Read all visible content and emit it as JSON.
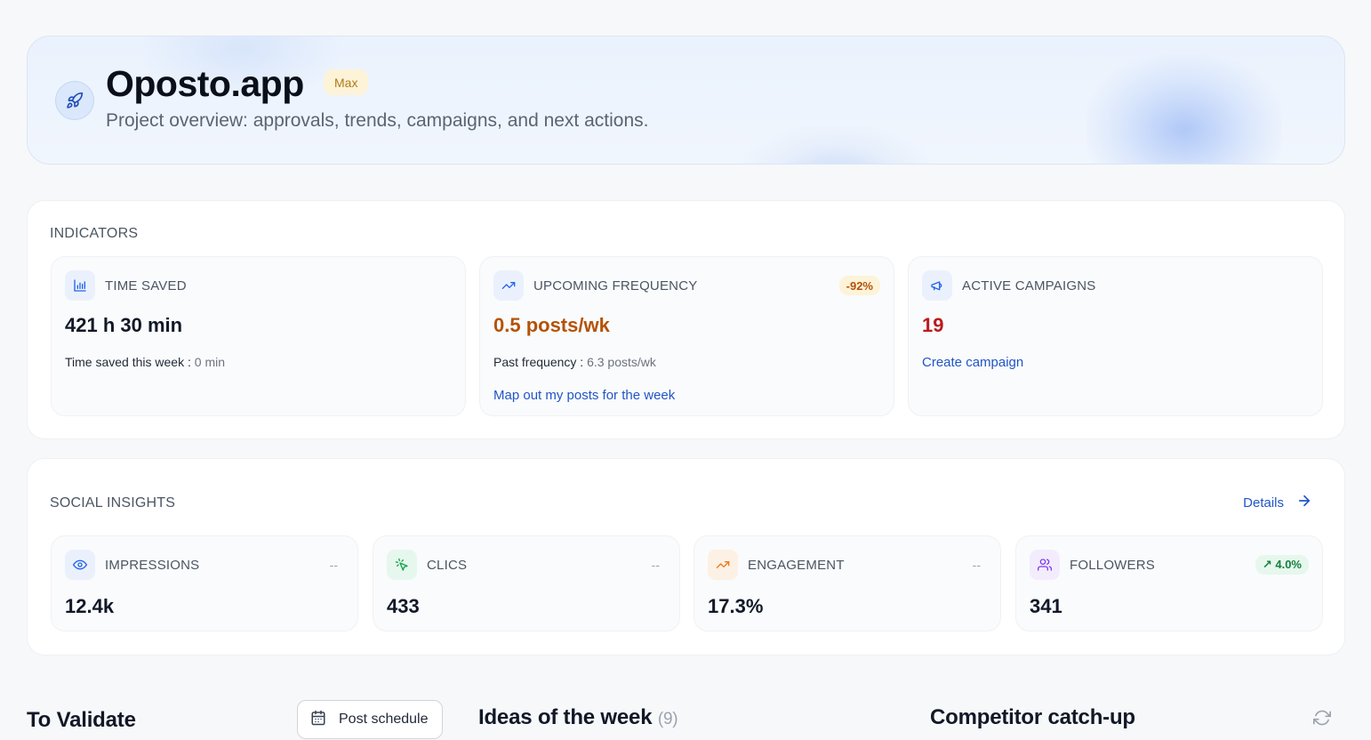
{
  "header": {
    "title": "Oposto.app",
    "badge": "Max",
    "subtitle": "Project overview: approvals, trends, campaigns, and next actions.",
    "icon": "rocket-icon"
  },
  "indicators": {
    "section_title": "INDICATORS",
    "time_saved": {
      "label": "TIME SAVED",
      "icon": "bar-chart-icon",
      "value": "421 h 30 min",
      "sub_label": "Time saved this week :",
      "sub_value": "0 min"
    },
    "upcoming_frequency": {
      "label": "UPCOMING FREQUENCY",
      "icon": "trend-up-icon",
      "badge": "-92%",
      "value": "0.5 posts/wk",
      "sub_label": "Past frequency :",
      "sub_value": "6.3 posts/wk",
      "link": "Map out my posts for the week"
    },
    "active_campaigns": {
      "label": "ACTIVE CAMPAIGNS",
      "icon": "megaphone-icon",
      "value": "19",
      "link": "Create campaign"
    }
  },
  "social_insights": {
    "section_title": "SOCIAL INSIGHTS",
    "details_label": "Details",
    "tiles": [
      {
        "label": "IMPRESSIONS",
        "icon": "eye-icon",
        "value": "12.4k",
        "delta": "--"
      },
      {
        "label": "CLICS",
        "icon": "cursor-click-icon",
        "value": "433",
        "delta": "--"
      },
      {
        "label": "ENGAGEMENT",
        "icon": "trend-up-icon",
        "value": "17.3%",
        "delta": "--"
      },
      {
        "label": "FOLLOWERS",
        "icon": "users-icon",
        "value": "341",
        "delta": "↗ 4.0%"
      }
    ]
  },
  "bottom": {
    "to_validate": "To Validate",
    "post_schedule": "Post schedule",
    "ideas_title": "Ideas of the week",
    "ideas_count": "(9)",
    "competitor_title": "Competitor catch-up"
  },
  "colors": {
    "accent_blue": "#2155c7",
    "frequency_orange": "#b45309",
    "campaigns_red": "#b91c1c",
    "badge_warning_bg": "#fdf3d8",
    "badge_success_bg": "#e6f7ee"
  }
}
